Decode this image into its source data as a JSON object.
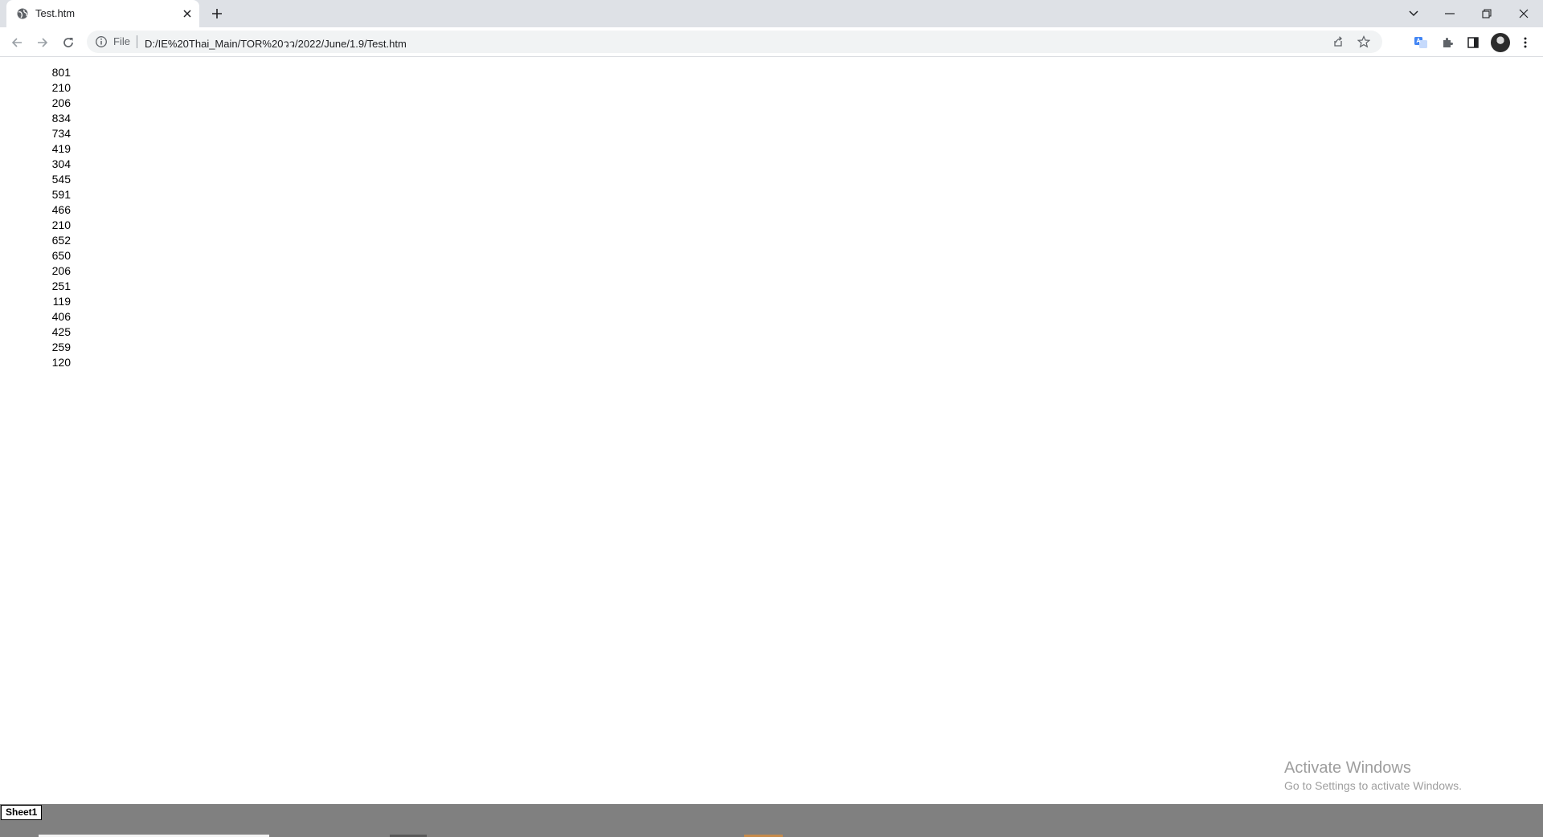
{
  "browser": {
    "tab": {
      "title": "Test.htm"
    },
    "address": {
      "scheme_label": "File",
      "url": "D:/IE%20Thai_Main/TOR%20วว/2022/June/1.9/Test.htm"
    }
  },
  "content": {
    "values": [
      "801",
      "210",
      "206",
      "834",
      "734",
      "419",
      "304",
      "545",
      "591",
      "466",
      "210",
      "652",
      "650",
      "206",
      "251",
      "119",
      "406",
      "425",
      "259",
      "120"
    ]
  },
  "watermark": {
    "title": "Activate Windows",
    "subtitle": "Go to Settings to activate Windows."
  },
  "sheets": {
    "active_tab": "Sheet1"
  },
  "colors": {
    "tabstrip": "#dee1e6",
    "omnibox": "#f1f3f4",
    "sheetbar": "#808080",
    "text": "#202124"
  }
}
